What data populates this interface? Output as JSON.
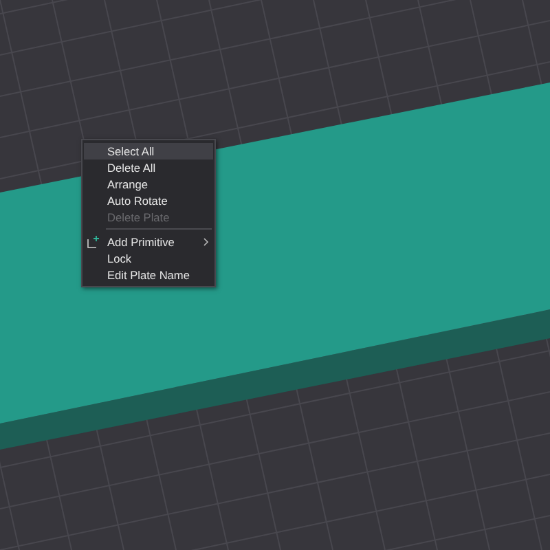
{
  "context_menu": {
    "items": [
      {
        "kind": "plain",
        "label": "Select All",
        "selected": true,
        "disabled": false
      },
      {
        "kind": "plain",
        "label": "Delete All",
        "selected": false,
        "disabled": false
      },
      {
        "kind": "plain",
        "label": "Arrange",
        "selected": false,
        "disabled": false
      },
      {
        "kind": "plain",
        "label": "Auto Rotate",
        "selected": false,
        "disabled": false
      },
      {
        "kind": "plain",
        "label": "Delete Plate",
        "selected": false,
        "disabled": true
      },
      {
        "kind": "separator"
      },
      {
        "kind": "submenu",
        "label": "Add Primitive",
        "selected": false,
        "disabled": false
      },
      {
        "kind": "plain",
        "label": "Lock",
        "selected": false,
        "disabled": false
      },
      {
        "kind": "plain",
        "label": "Edit Plate Name",
        "selected": false,
        "disabled": false
      }
    ]
  }
}
